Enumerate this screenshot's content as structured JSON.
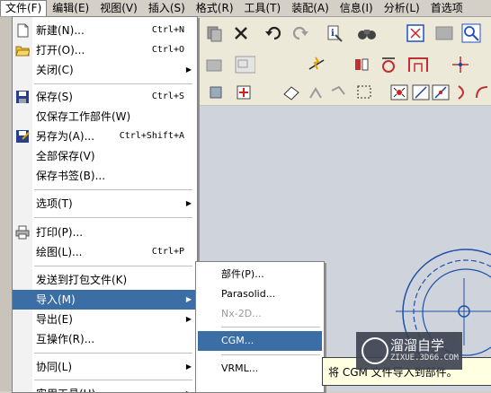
{
  "menubar": {
    "items": [
      "文件(F)",
      "编辑(E)",
      "视图(V)",
      "插入(S)",
      "格式(R)",
      "工具(T)",
      "装配(A)",
      "信息(I)",
      "分析(L)",
      "首选项"
    ]
  },
  "file_menu": {
    "items": [
      {
        "label": "新建(N)...",
        "shortcut": "Ctrl+N",
        "icon": "new-file-icon"
      },
      {
        "label": "打开(O)...",
        "shortcut": "Ctrl+O",
        "icon": "open-folder-icon"
      },
      {
        "label": "关闭(C)",
        "submenu": true
      },
      {
        "label": "保存(S)",
        "shortcut": "Ctrl+S",
        "icon": "save-icon"
      },
      {
        "label": "仅保存工作部件(W)"
      },
      {
        "label": "另存为(A)...",
        "shortcut": "Ctrl+Shift+A",
        "icon": "save-as-icon"
      },
      {
        "label": "全部保存(V)"
      },
      {
        "label": "保存书签(B)..."
      },
      {
        "label": "选项(T)",
        "submenu": true
      },
      {
        "label": "打印(P)...",
        "icon": "printer-icon"
      },
      {
        "label": "绘图(L)...",
        "shortcut": "Ctrl+P"
      },
      {
        "label": "发送到打包文件(K)"
      },
      {
        "label": "导入(M)",
        "submenu": true,
        "highlighted": true
      },
      {
        "label": "导出(E)",
        "submenu": true
      },
      {
        "label": "互操作(R)..."
      },
      {
        "label": "协同(L)",
        "submenu": true
      },
      {
        "label": "实用工具(U)",
        "submenu": true
      }
    ]
  },
  "import_submenu": {
    "items": [
      {
        "label": "部件(P)..."
      },
      {
        "label": "Parasolid..."
      },
      {
        "label": "Nx-2D...",
        "disabled": true
      },
      {
        "label": "CGM...",
        "highlighted": true
      },
      {
        "label": "VRML..."
      }
    ]
  },
  "tooltip": {
    "text": "将 CGM 文件导入到部件。"
  },
  "watermark": {
    "title": "溜溜自学",
    "url": "ZIXUE.3D66.COM"
  },
  "colors": {
    "highlight": "#3a6ea5",
    "menu_bg": "#ffffff",
    "chrome": "#d4d0c8",
    "canvas": "#cfd4dc",
    "drawing": "#1f4fa8"
  }
}
